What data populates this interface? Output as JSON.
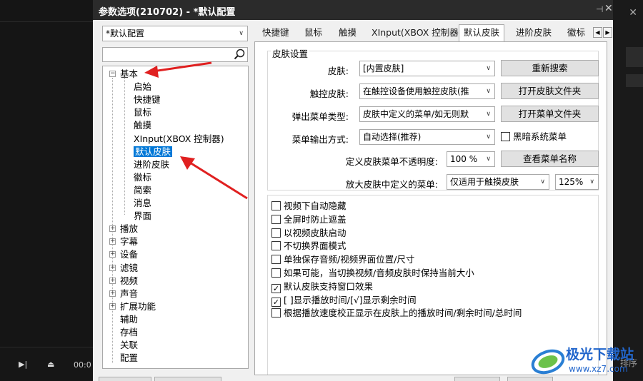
{
  "dialog": {
    "title": "参数选项(210702) - *默认配置",
    "profile_value": "*默认配置"
  },
  "tree": {
    "items": [
      {
        "label": "基本",
        "expander": "−"
      },
      {
        "label": "启始"
      },
      {
        "label": "快捷键"
      },
      {
        "label": "鼠标"
      },
      {
        "label": "触摸"
      },
      {
        "label": "XInput(XBOX 控制器)"
      },
      {
        "label": "默认皮肤",
        "selected": true
      },
      {
        "label": "进阶皮肤"
      },
      {
        "label": "徽标"
      },
      {
        "label": "简索"
      },
      {
        "label": "消息"
      },
      {
        "label": "界面"
      },
      {
        "label": "播放",
        "expander": "+"
      },
      {
        "label": "字幕",
        "expander": "+"
      },
      {
        "label": "设备",
        "expander": "+"
      },
      {
        "label": "滤镜",
        "expander": "+"
      },
      {
        "label": "视频",
        "expander": "+"
      },
      {
        "label": "声音",
        "expander": "+"
      },
      {
        "label": "扩展功能",
        "expander": "+"
      },
      {
        "label": "辅助"
      },
      {
        "label": "存档"
      },
      {
        "label": "关联"
      },
      {
        "label": "配置"
      }
    ]
  },
  "tabs": [
    "快捷键",
    "鼠标",
    "触摸",
    "XInput(XBOX 控制器)",
    "默认皮肤",
    "进阶皮肤",
    "徽标"
  ],
  "skin_settings": {
    "group_title": "皮肤设置",
    "skin_label": "皮肤:",
    "skin_value": "[内置皮肤]",
    "touch_skin_label": "触控皮肤:",
    "touch_skin_value": "在触控设备使用触控皮肤(推",
    "popup_menu_label": "弹出菜单类型:",
    "popup_menu_value": "皮肤中定义的菜单/如无则默",
    "menu_output_label": "菜单输出方式:",
    "menu_output_value": "自动选择(推荐)",
    "dark_menu_label": "黑暗系统菜单",
    "opacity_label": "定义皮肤菜单不透明度:",
    "opacity_value": "100 %",
    "zoom_label": "放大皮肤中定义的菜单:",
    "zoom_mode_value": "仅适用于触摸皮肤",
    "zoom_pct_value": "125%",
    "btn_research": "重新搜索",
    "btn_open_skin_folder": "打开皮肤文件夹",
    "btn_open_menu_folder": "打开菜单文件夹",
    "btn_view_menu_name": "查看菜单名称"
  },
  "options": [
    {
      "label": "视频下自动隐藏",
      "checked": false
    },
    {
      "label": "全屏时防止遮盖",
      "checked": false
    },
    {
      "label": "以视频皮肤启动",
      "checked": false
    },
    {
      "label": "不切换界面模式",
      "checked": false
    },
    {
      "label": "单独保存音频/视频界面位置/尺寸",
      "checked": false
    },
    {
      "label": "如果可能，当切换视频/音频皮肤时保持当前大小",
      "checked": false
    },
    {
      "label": "默认皮肤支持窗口效果",
      "checked": true
    },
    {
      "label": "[ ]显示播放时间/[√]显示剩余时间",
      "checked": true
    },
    {
      "label": "根据播放速度校正显示在皮肤上的播放时间/剩余时间/总时间",
      "checked": false
    }
  ],
  "player": {
    "time_text": "00:0",
    "side_text": "排序"
  },
  "watermark": {
    "brand": "极光下载站",
    "url": "www.xz7.com"
  },
  "colors": {
    "accent": "#0078d7",
    "arrow": "#e02020",
    "titlebar": "#2b2b2b"
  }
}
